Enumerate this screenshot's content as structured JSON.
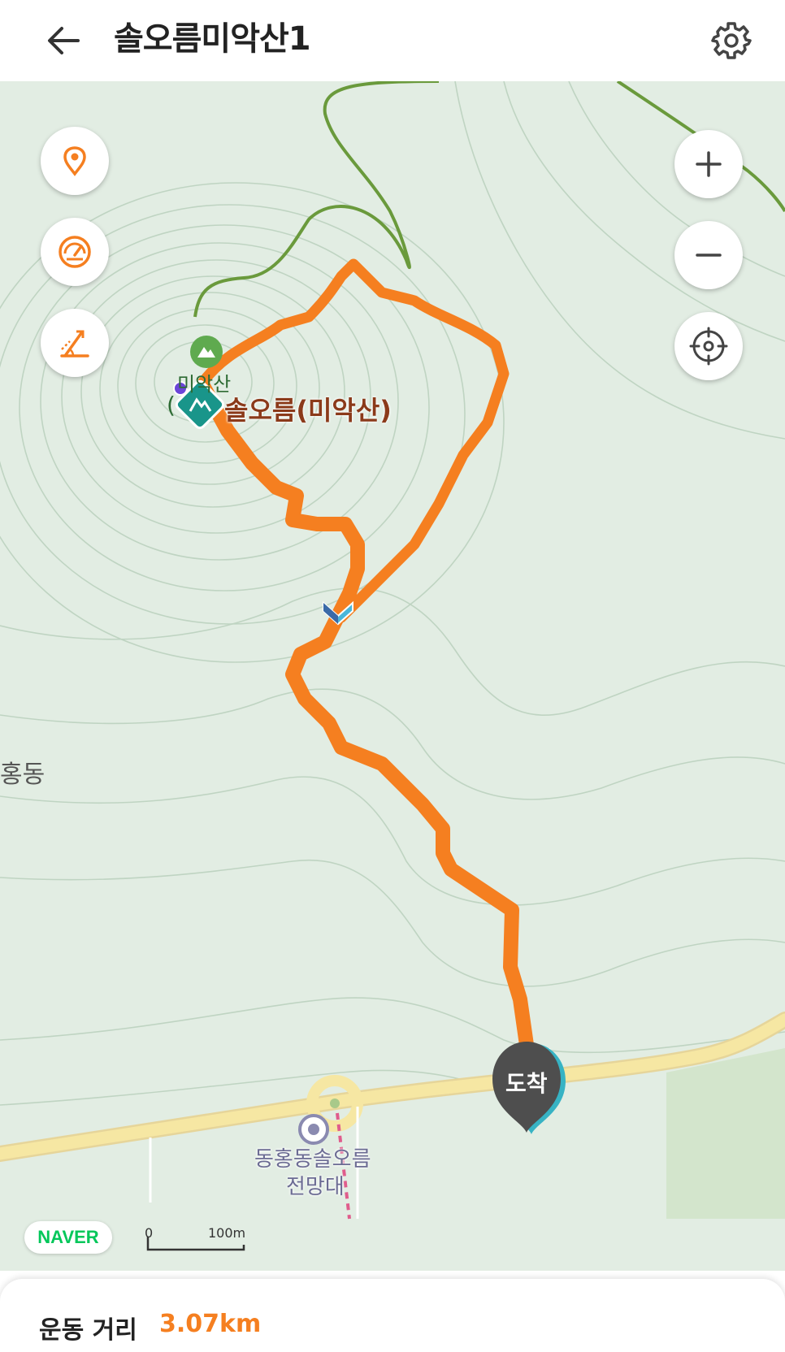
{
  "header": {
    "title": "솔오름미악산1",
    "back_icon": "arrow-left-icon",
    "settings_icon": "gear-icon"
  },
  "map": {
    "labels": {
      "peak_name_top": "미악산",
      "peak_name_main": "솔오름(미악산)",
      "peak_paren_prefix": "(",
      "district_left": "홍동",
      "viewpoint_line1": "동홍동솔오름",
      "viewpoint_line2": "전망대",
      "arrival": "도착"
    },
    "controls": {
      "left": [
        "location-pin-icon",
        "speedometer-icon",
        "slope-icon"
      ],
      "right": [
        "zoom-in-icon",
        "zoom-out-icon",
        "current-location-icon"
      ]
    },
    "logo": "NAVER",
    "scale": {
      "zero": "0",
      "distance": "100m"
    },
    "colors": {
      "route": "#f57f20",
      "trail": "#6a9a3c",
      "road": "#f6e7a3",
      "map_bg": "#e2ede3",
      "contour": "#bfd4c2"
    }
  },
  "summary": {
    "distance_label": "운동 거리",
    "distance_value": "3.07km"
  }
}
